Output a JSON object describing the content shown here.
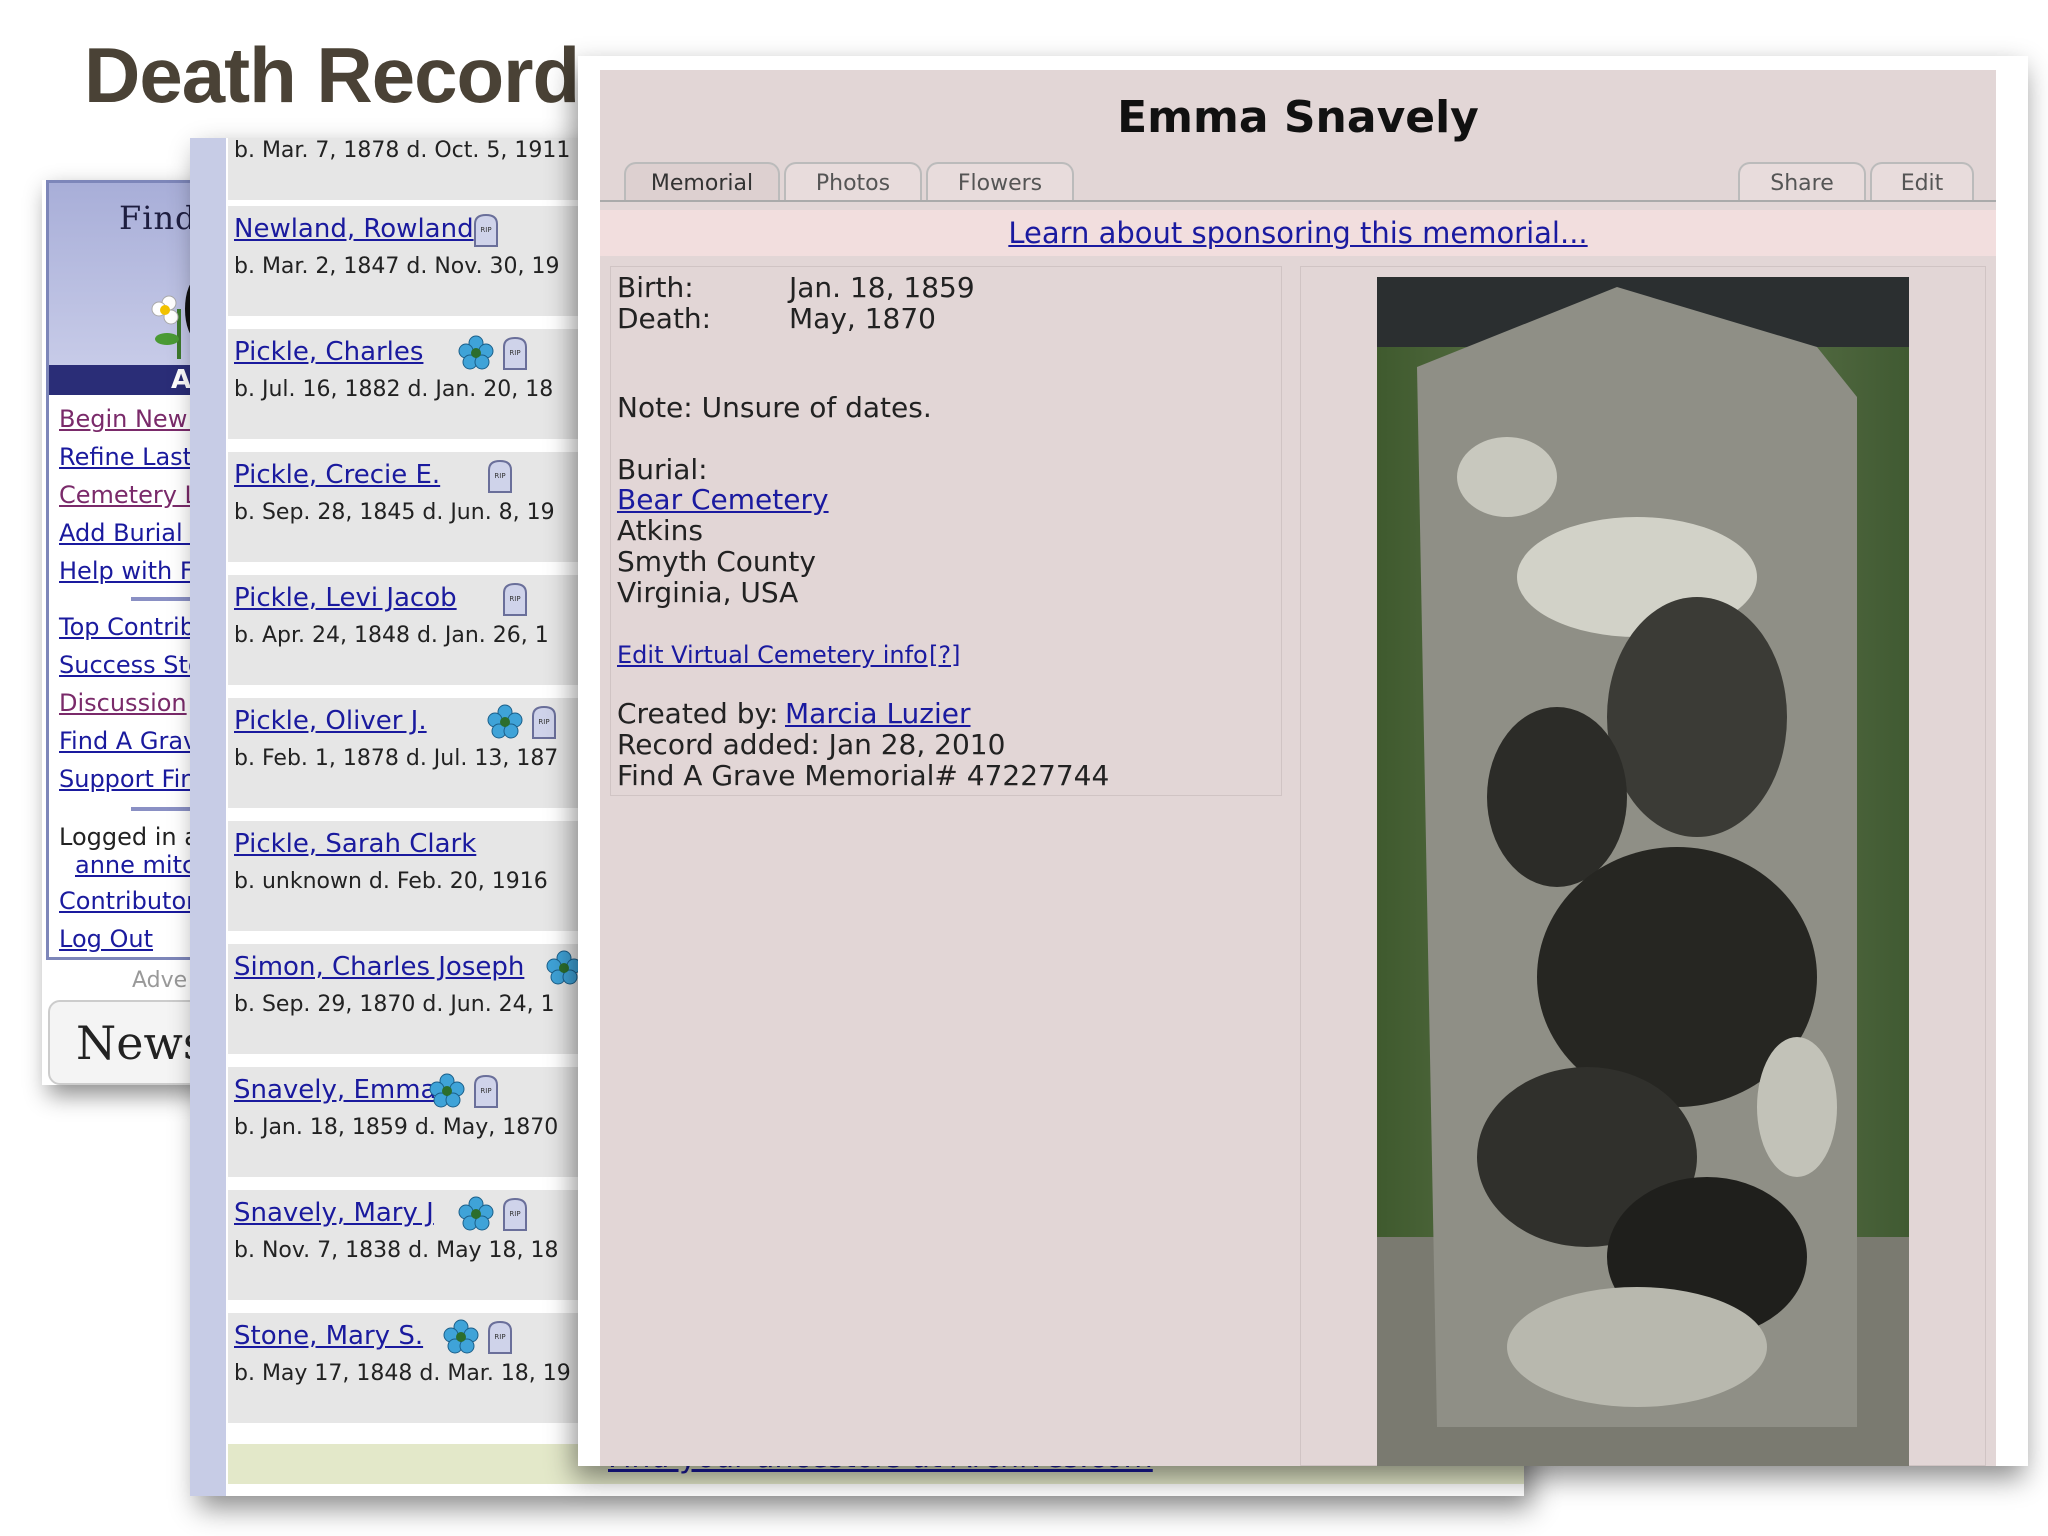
{
  "slide": {
    "title": "Death Records"
  },
  "sidebar": {
    "logo_text": "Find",
    "header": "A",
    "links": [
      {
        "label": "Begin New :",
        "visited": true
      },
      {
        "label": "Refine Last",
        "visited": false
      },
      {
        "label": "Cemetery L",
        "visited": true
      },
      {
        "label": "Add Burial I",
        "visited": false
      },
      {
        "label": "Help with Fi",
        "visited": false
      },
      {
        "label": "Top Contrib",
        "visited": false
      },
      {
        "label": "Success Sto",
        "visited": false
      },
      {
        "label": "Discussion",
        "visited": true
      },
      {
        "label": "Find A Grav",
        "visited": false
      },
      {
        "label": "Support Fin",
        "visited": false
      }
    ],
    "logged_in_label": "Logged in a",
    "user_name": "anne mitc",
    "contributor_link": "Contributor",
    "logout_link": "Log Out",
    "ad_label": "Adve",
    "news_label": "News"
  },
  "results": {
    "first_dates": "b. Mar. 7, 1878 d. Oct. 5, 1911",
    "rows": [
      {
        "name": "Newland, Rowland",
        "dates": "b. Mar. 2, 1847 d. Nov. 30, 19",
        "flower": false,
        "rip": true
      },
      {
        "name": "Pickle, Charles",
        "dates": "b. Jul. 16, 1882 d. Jan. 20, 18",
        "flower": true,
        "rip": true
      },
      {
        "name": "Pickle, Crecie E.",
        "dates": "b. Sep. 28, 1845 d. Jun. 8, 19",
        "flower": false,
        "rip": true
      },
      {
        "name": "Pickle, Levi Jacob",
        "dates": "b. Apr. 24, 1848 d. Jan. 26, 1",
        "flower": false,
        "rip": true
      },
      {
        "name": "Pickle, Oliver J.",
        "dates": "b. Feb. 1, 1878 d. Jul. 13, 187",
        "flower": true,
        "rip": true
      },
      {
        "name": "Pickle, Sarah Clark",
        "dates": "b. unknown d. Feb. 20, 1916",
        "flower": false,
        "rip": false
      },
      {
        "name": "Simon, Charles Joseph",
        "dates": "b. Sep. 29, 1870 d. Jun. 24, 1",
        "flower": true,
        "rip": false
      },
      {
        "name": "Snavely, Emma",
        "dates": "b. Jan. 18, 1859 d. May, 1870",
        "flower": true,
        "rip": true
      },
      {
        "name": "Snavely, Mary J",
        "dates": "b. Nov. 7, 1838 d. May 18, 18",
        "flower": true,
        "rip": true
      },
      {
        "name": "Stone, Mary S.",
        "dates": "b. May 17, 1848 d. Mar. 18, 19",
        "flower": true,
        "rip": true
      }
    ],
    "rip_label": "RIP",
    "footer_link": "Find your ancestors at Archives.com"
  },
  "memorial": {
    "name": "Emma Snavely",
    "tabs": [
      "Memorial",
      "Photos",
      "Flowers"
    ],
    "actions": [
      "Share",
      "Edit"
    ],
    "sponsor_link": "Learn about sponsoring this memorial...",
    "birth_label": "Birth:",
    "birth_value": "Jan. 18, 1859",
    "death_label": "Death:",
    "death_value": "May, 1870",
    "note": "Note: Unsure of dates.",
    "burial_label": "Burial:",
    "cemetery_link": "Bear Cemetery",
    "location_lines": [
      "Atkins",
      "Smyth County",
      "Virginia, USA"
    ],
    "virtual_cemetery_link": "Edit Virtual Cemetery info",
    "help_link": "[?]",
    "created_by_label": "Created by:",
    "created_by_link": "Marcia Luzier",
    "record_added": "Record added: Jan 28, 2010",
    "memorial_number": "Find A Grave Memorial# 47227744"
  }
}
